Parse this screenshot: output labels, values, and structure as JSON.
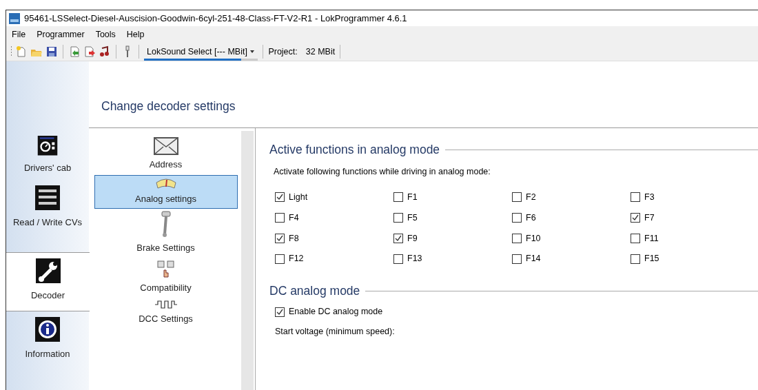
{
  "window": {
    "title": "95461-LSSelect-Diesel-Auscision-Goodwin-6cyl-251-48-Class-FT-V2-R1 - LokProgrammer 4.6.1"
  },
  "menu": [
    "File",
    "Programmer",
    "Tools",
    "Help"
  ],
  "toolbar": {
    "device": "LokSound Select [--- MBit]",
    "progress": {
      "level": 0.85
    },
    "project_label": "Project:",
    "project_value": "32 MBit"
  },
  "header": "Change decoder settings",
  "nav_tabs": [
    {
      "label": "Drivers' cab",
      "kind": "cab",
      "selected": false
    },
    {
      "label": "Read / Write CVs",
      "kind": "cv",
      "selected": false
    },
    {
      "label": "Decoder",
      "kind": "decoder",
      "selected": true
    },
    {
      "label": "Information",
      "kind": "info",
      "selected": false
    }
  ],
  "settings_list": [
    {
      "label": "Address",
      "kind": "address",
      "selected": false
    },
    {
      "label": "Analog settings",
      "kind": "analog",
      "selected": true
    },
    {
      "label": "Brake Settings",
      "kind": "brake",
      "selected": false
    },
    {
      "label": "Compatibility",
      "kind": "compat",
      "selected": false
    },
    {
      "label": "DCC Settings",
      "kind": "dcc",
      "selected": false
    }
  ],
  "sections": [
    {
      "title": "Active functions in analog mode",
      "description": "Activate following functions while driving in analog mode:",
      "functions": [
        {
          "label": "Light",
          "checked": true
        },
        {
          "label": "F1",
          "checked": false
        },
        {
          "label": "F2",
          "checked": false
        },
        {
          "label": "F3",
          "checked": false
        },
        {
          "label": "F4",
          "checked": false
        },
        {
          "label": "F5",
          "checked": false
        },
        {
          "label": "F6",
          "checked": false
        },
        {
          "label": "F7",
          "checked": true
        },
        {
          "label": "F8",
          "checked": true
        },
        {
          "label": "F9",
          "checked": true
        },
        {
          "label": "F10",
          "checked": false
        },
        {
          "label": "F11",
          "checked": false
        },
        {
          "label": "F12",
          "checked": false
        },
        {
          "label": "F13",
          "checked": false
        },
        {
          "label": "F14",
          "checked": false
        },
        {
          "label": "F15",
          "checked": false
        }
      ]
    },
    {
      "title": "DC analog mode",
      "options": [
        {
          "label": "Enable DC analog mode",
          "checked": true
        }
      ],
      "note": "Start voltage (minimum speed):"
    }
  ]
}
